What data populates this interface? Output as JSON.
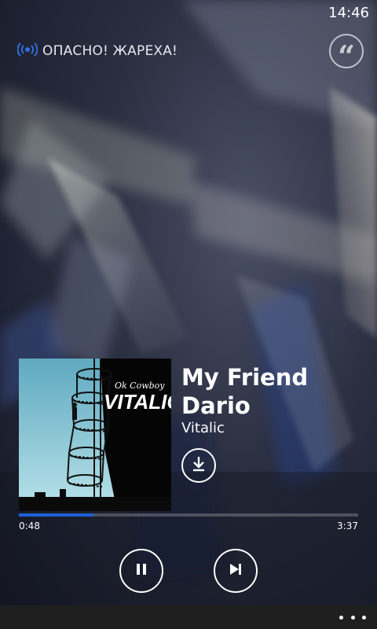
{
  "status_bar": {
    "time": "14:46"
  },
  "station": {
    "name": "ОПАСНО! ЖАРЕХА!",
    "icon": "radio-broadcast-icon",
    "accent_color": "#2f6fe0"
  },
  "actions": {
    "quote_icon": "quote-icon",
    "download_icon": "download-icon"
  },
  "album_art": {
    "title_text": "Ok Cowboy",
    "artist_text": "VITALIC"
  },
  "track": {
    "title": "My Friend Dario",
    "artist": "Vitalic"
  },
  "progress": {
    "elapsed": "0:48",
    "total": "3:37",
    "fraction": 0.221,
    "color": "#1e5fd6"
  },
  "controls": {
    "pause_icon": "pause-icon",
    "next_icon": "skip-next-icon"
  },
  "app_bar": {
    "more_icon": "more-dots-icon"
  }
}
